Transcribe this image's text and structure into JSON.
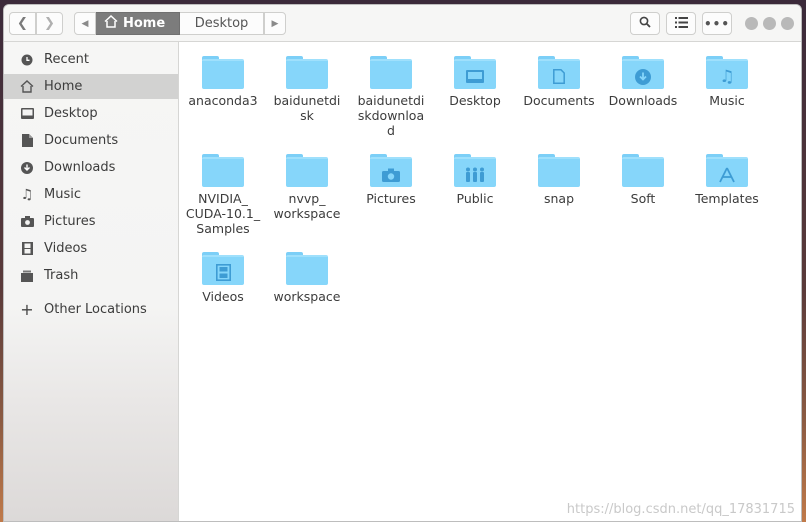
{
  "header": {
    "back_icon": "chevron-left-icon",
    "forward_icon": "chevron-right-icon",
    "path_left_icon": "triangle-left-icon",
    "path_right_icon": "triangle-right-icon",
    "crumbs": [
      {
        "label": "Home",
        "icon": "home-icon",
        "active": true
      },
      {
        "label": "Desktop",
        "active": false
      }
    ],
    "search_icon": "search-icon",
    "view_icon": "list-view-icon",
    "menu_icon": "more-options-icon"
  },
  "sidebar": {
    "items": [
      {
        "label": "Recent",
        "icon": "clock-icon"
      },
      {
        "label": "Home",
        "icon": "home-icon",
        "selected": true
      },
      {
        "label": "Desktop",
        "icon": "desktop-icon"
      },
      {
        "label": "Documents",
        "icon": "document-icon"
      },
      {
        "label": "Downloads",
        "icon": "download-icon"
      },
      {
        "label": "Music",
        "icon": "music-note-icon"
      },
      {
        "label": "Pictures",
        "icon": "camera-icon"
      },
      {
        "label": "Videos",
        "icon": "film-icon"
      },
      {
        "label": "Trash",
        "icon": "trash-icon"
      },
      {
        "label": "Other Locations",
        "icon": "plus-icon"
      }
    ]
  },
  "files": [
    {
      "label": "anaconda3",
      "emblem": ""
    },
    {
      "label": "baidunetdi\nsk",
      "emblem": ""
    },
    {
      "label": "baidunetdi\nskdownloa\nd",
      "emblem": ""
    },
    {
      "label": "Desktop",
      "emblem": "desktop-icon"
    },
    {
      "label": "Documents",
      "emblem": "document-icon"
    },
    {
      "label": "Downloads",
      "emblem": "download-icon"
    },
    {
      "label": "Music",
      "emblem": "music-note-icon"
    },
    {
      "label": "NVIDIA_\nCUDA-10.1_\nSamples",
      "emblem": ""
    },
    {
      "label": "nvvp_\nworkspace",
      "emblem": ""
    },
    {
      "label": "Pictures",
      "emblem": "camera-icon"
    },
    {
      "label": "Public",
      "emblem": "people-icon"
    },
    {
      "label": "snap",
      "emblem": ""
    },
    {
      "label": "Soft",
      "emblem": ""
    },
    {
      "label": "Templates",
      "emblem": "templates-icon"
    },
    {
      "label": "Videos",
      "emblem": "film-icon"
    },
    {
      "label": "workspace",
      "emblem": ""
    }
  ],
  "watermark": "https://blog.csdn.net/qq_17831715",
  "colors": {
    "folder": "#86d6fa",
    "folder_emblem": "#3e9cd4",
    "selected_sidebar": "#d2d2d1",
    "active_crumb": "#7c7c7c"
  }
}
